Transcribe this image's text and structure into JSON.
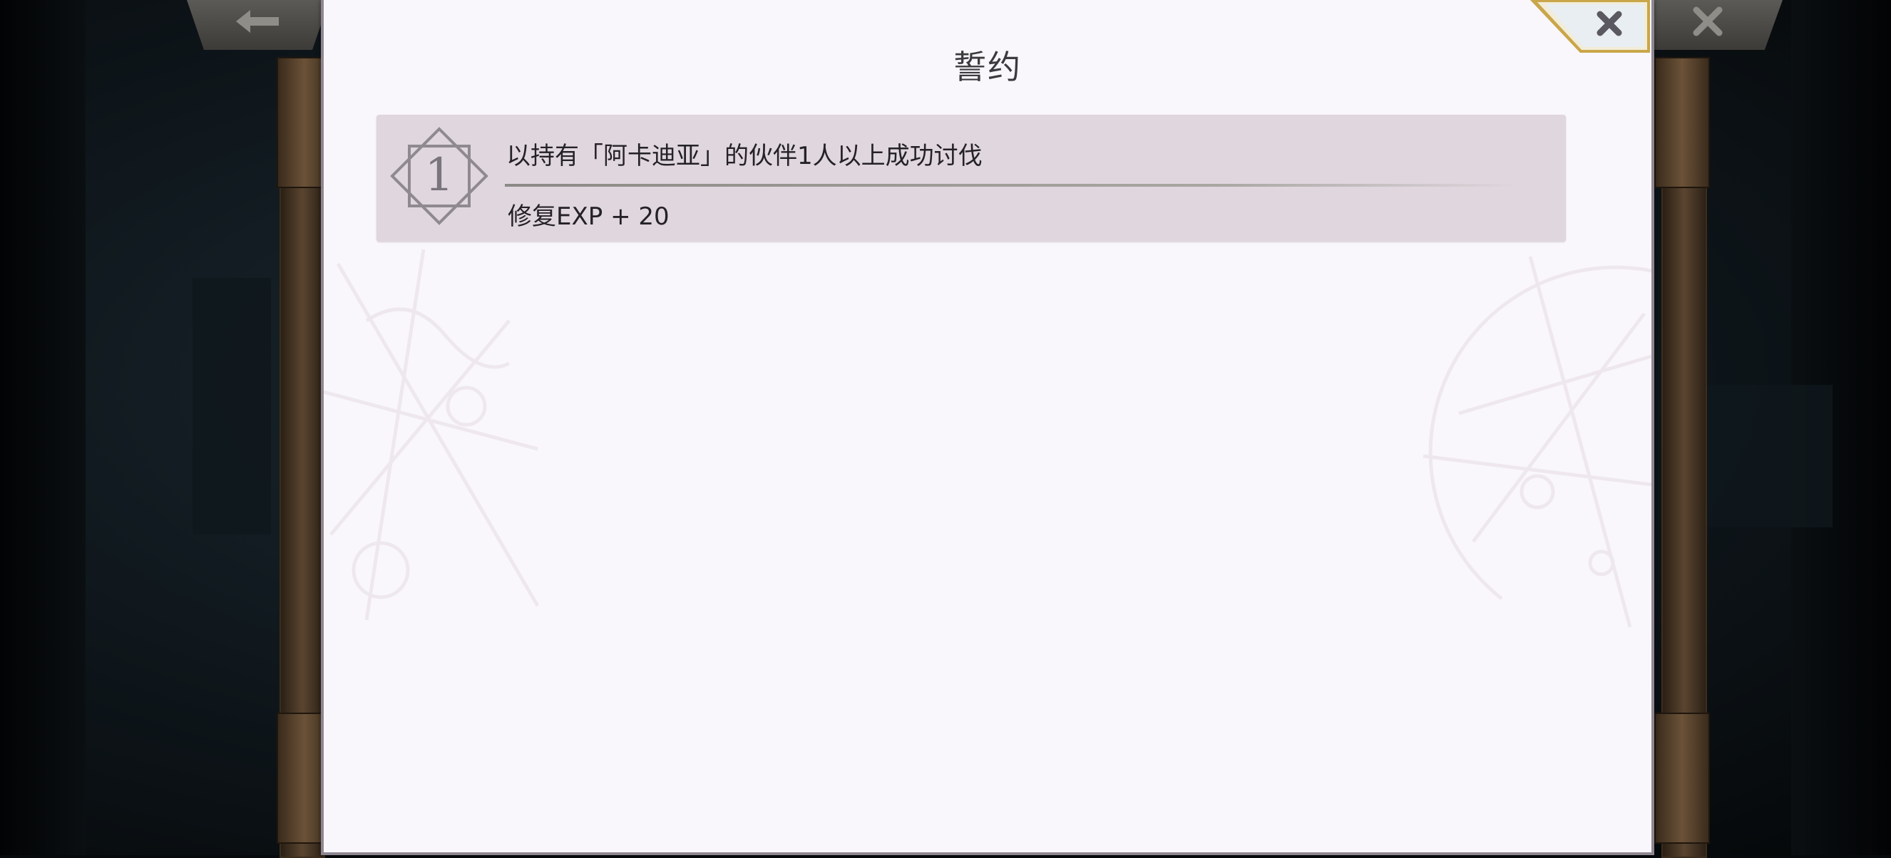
{
  "dialog": {
    "title": "誓约",
    "close_icon": "close-icon"
  },
  "underlying": {
    "back_icon": "back-arrow-icon",
    "close_icon": "close-icon",
    "back_glyph": "🡐",
    "close_glyph": "✕"
  },
  "missions": [
    {
      "number": "1",
      "condition": "以持有「阿卡迪亚」的伙伴1人以上成功讨伐",
      "reward": "修复EXP + 20"
    }
  ],
  "colors": {
    "dialog_bg": "#f9f7fb",
    "row_bg": "#e0d6de",
    "accent_gold": "#c9a64a"
  }
}
